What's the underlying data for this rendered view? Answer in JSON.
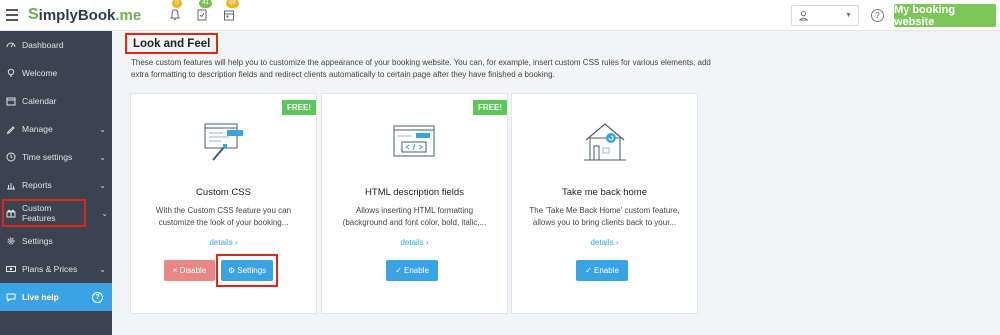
{
  "header": {
    "logo_s": "S",
    "logo_main": "implyBook",
    "logo_me": ".me",
    "notifications": [
      {
        "icon": "bell-icon",
        "badge": "0"
      },
      {
        "icon": "clipboard-check-icon",
        "badge": "41"
      },
      {
        "icon": "calendar-icon",
        "badge": "off"
      }
    ],
    "my_booking_label": "My booking website"
  },
  "sidebar": {
    "items": [
      {
        "label": "Dashboard",
        "icon": "dashboard-icon",
        "has_chevron": false
      },
      {
        "label": "Welcome",
        "icon": "lightbulb-icon",
        "has_chevron": false
      },
      {
        "label": "Calendar",
        "icon": "calendar-icon",
        "has_chevron": false
      },
      {
        "label": "Manage",
        "icon": "pencil-icon",
        "has_chevron": true
      },
      {
        "label": "Time settings",
        "icon": "clock-icon",
        "has_chevron": true
      },
      {
        "label": "Reports",
        "icon": "bar-chart-icon",
        "has_chevron": true
      },
      {
        "label": "Custom Features",
        "icon": "gift-icon",
        "has_chevron": true
      },
      {
        "label": "Settings",
        "icon": "gear-icon",
        "has_chevron": false
      },
      {
        "label": "Plans & Prices",
        "icon": "money-icon",
        "has_chevron": true
      }
    ],
    "live_help": "Live help",
    "live_help_icon": "?"
  },
  "main": {
    "title": "Look and Feel",
    "intro": "These custom features will help you to customize the appearance of your booking website. You can, for example, insert custom CSS rules for various elements, add extra formatting to description fields and redirect clients automatically to certain page after they have finished a booking.",
    "cards": [
      {
        "free_badge": "FREE!",
        "title": "Custom CSS",
        "description": "With the Custom CSS feature you can customize the look of your booking...",
        "details": "details ›",
        "disable_label": "× Disable",
        "settings_label": "⚙ Settings"
      },
      {
        "free_badge": "FREE!",
        "title": "HTML description fields",
        "description": "Allows inserting HTML formatting (background and font color, bold, italic,...",
        "details": "details ›",
        "enable_label": "✓ Enable"
      },
      {
        "title": "Take me back home",
        "description": "The 'Take Me Back Home' custom feature, allows you to bring clients back to your...",
        "details": "details ›",
        "enable_label": "✓ Enable"
      }
    ]
  },
  "colors": {
    "brand_green": "#7cc65a",
    "sidebar_bg": "#3a4451",
    "accent_blue": "#3aa3e3",
    "highlight_red": "#e0251b",
    "disable_red": "#e98787"
  }
}
